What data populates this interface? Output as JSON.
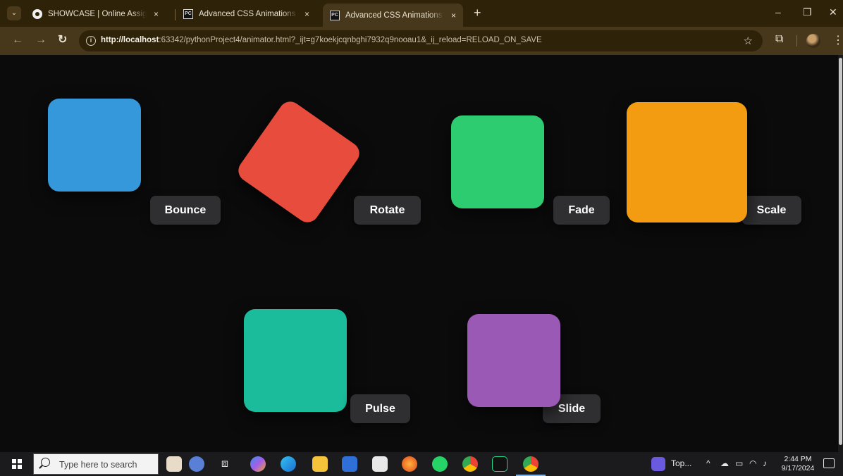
{
  "browser": {
    "tabs": [
      {
        "title": "SHOWCASE | Online Assignment Submission",
        "close": "×"
      },
      {
        "title": "Advanced CSS Animations Example",
        "close": "×"
      },
      {
        "title": "Advanced CSS Animations Example",
        "close": "×",
        "active": true
      }
    ],
    "new_tab": "+",
    "url_host": "http://localhost",
    "url_rest": ":63342/pythonProject4/animator.html?_ijt=g7koekjcqnbghi7932q9nooau1&_ij_reload=RELOAD_ON_SAVE",
    "window_controls": {
      "minimize": "–",
      "restore": "❐",
      "close": "✕"
    }
  },
  "page": {
    "background": "#0b0b0b",
    "demos": [
      {
        "label": "Bounce",
        "color": "#3498db"
      },
      {
        "label": "Rotate",
        "color": "#e74c3c",
        "rotation_deg": 35
      },
      {
        "label": "Fade",
        "color": "#2ecc71"
      },
      {
        "label": "Scale",
        "color": "#f39c12"
      },
      {
        "label": "Pulse",
        "color": "#1abc9c"
      },
      {
        "label": "Slide",
        "color": "#9b59b6"
      }
    ]
  },
  "taskbar": {
    "search_placeholder": "Type here to search",
    "tray_app_label": "Top...",
    "time": "2:44 PM",
    "date": "9/17/2024"
  }
}
